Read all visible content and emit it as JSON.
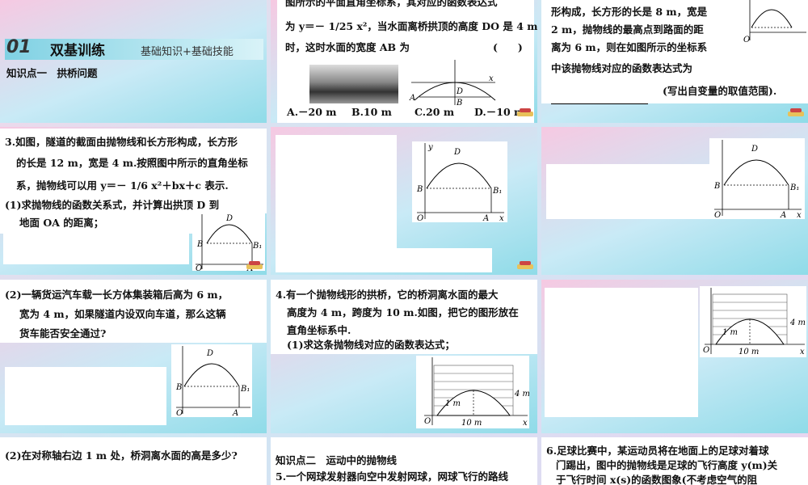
{
  "slide1": {
    "top_text": "图所示的平面直角坐标系，其对应的函数表达式",
    "line2": "为 y＝－ 1/25 x²，当水面离桥拱顶的高度 DO 是 4 m",
    "line3": "时，这时水面的宽度 AB 为",
    "paren": "(　　)",
    "options": [
      "A.－20 m",
      "B.10 m",
      "C.20 m",
      "D.－10 m"
    ]
  },
  "slide_header": {
    "section_num": "01",
    "section_title": "双基训练",
    "section_sub": "基础知识+基础技能",
    "knowledge_point": "知识点一　拱桥问题"
  },
  "slide2": {
    "line1": "形构成，长方形的长是 8 m，宽是",
    "line2": "2 m，抛物线的最高点到路面的距",
    "line3": "离为 6 m，则在如图所示的坐标系",
    "line4": "中该抛物线对应的函数表达式为",
    "line5": "(写出自变量的取值范围)."
  },
  "slide3": {
    "line1": "3.如图，隧道的截面由抛物线和长方形构成，长方形",
    "line2": "的长是 12 m，宽是 4 m.按照图中所示的直角坐标",
    "line3": "系，抛物线可以用 y＝－ 1/6 x²＋bx＋c 表示.",
    "q1a": "(1)求抛物线的函数关系式，并计算出拱顶 D 到",
    "q1b": "地面 OA 的距离；"
  },
  "slide7": {
    "line1": "(2)一辆货运汽车载一长方体集装箱后高为 6 m，",
    "line2": "宽为 4 m，如果隧道内设双向车道，那么这辆",
    "line3": "货车能否安全通过?"
  },
  "slide8": {
    "line1": "4.有一个抛物线形的拱桥，它的桥洞离水面的最大",
    "line2": "高度为 4 m，跨度为 10 m.如图，把它的图形放在",
    "line3": "直角坐标系中.",
    "line4": "(1)求这条抛物线对应的函数表达式；"
  },
  "slide10": {
    "text": "(2)在对称轴右边 1 m 处，桥洞离水面的高是多少?"
  },
  "slide11": {
    "kp": "知识点二　运动中的抛物线",
    "line1": "5.一个网球发射器向空中发射网球，网球飞行的路线"
  },
  "slide12": {
    "line1": "6.足球比赛中，某运动员将在地面上的足球对着球",
    "line2": "门踢出，图中的抛物线是足球的飞行高度 y(m)关",
    "line3": "于飞行时间 x(s)的函数图象(不考虑空气的阻"
  },
  "figure_labels": {
    "y": "y",
    "x": "x",
    "O": "O",
    "A": "A",
    "B": "B",
    "B1": "B₁",
    "D": "D",
    "C": "C",
    "one_m": "1 m",
    "four_m": "4 m",
    "ten_m": "10 m"
  }
}
